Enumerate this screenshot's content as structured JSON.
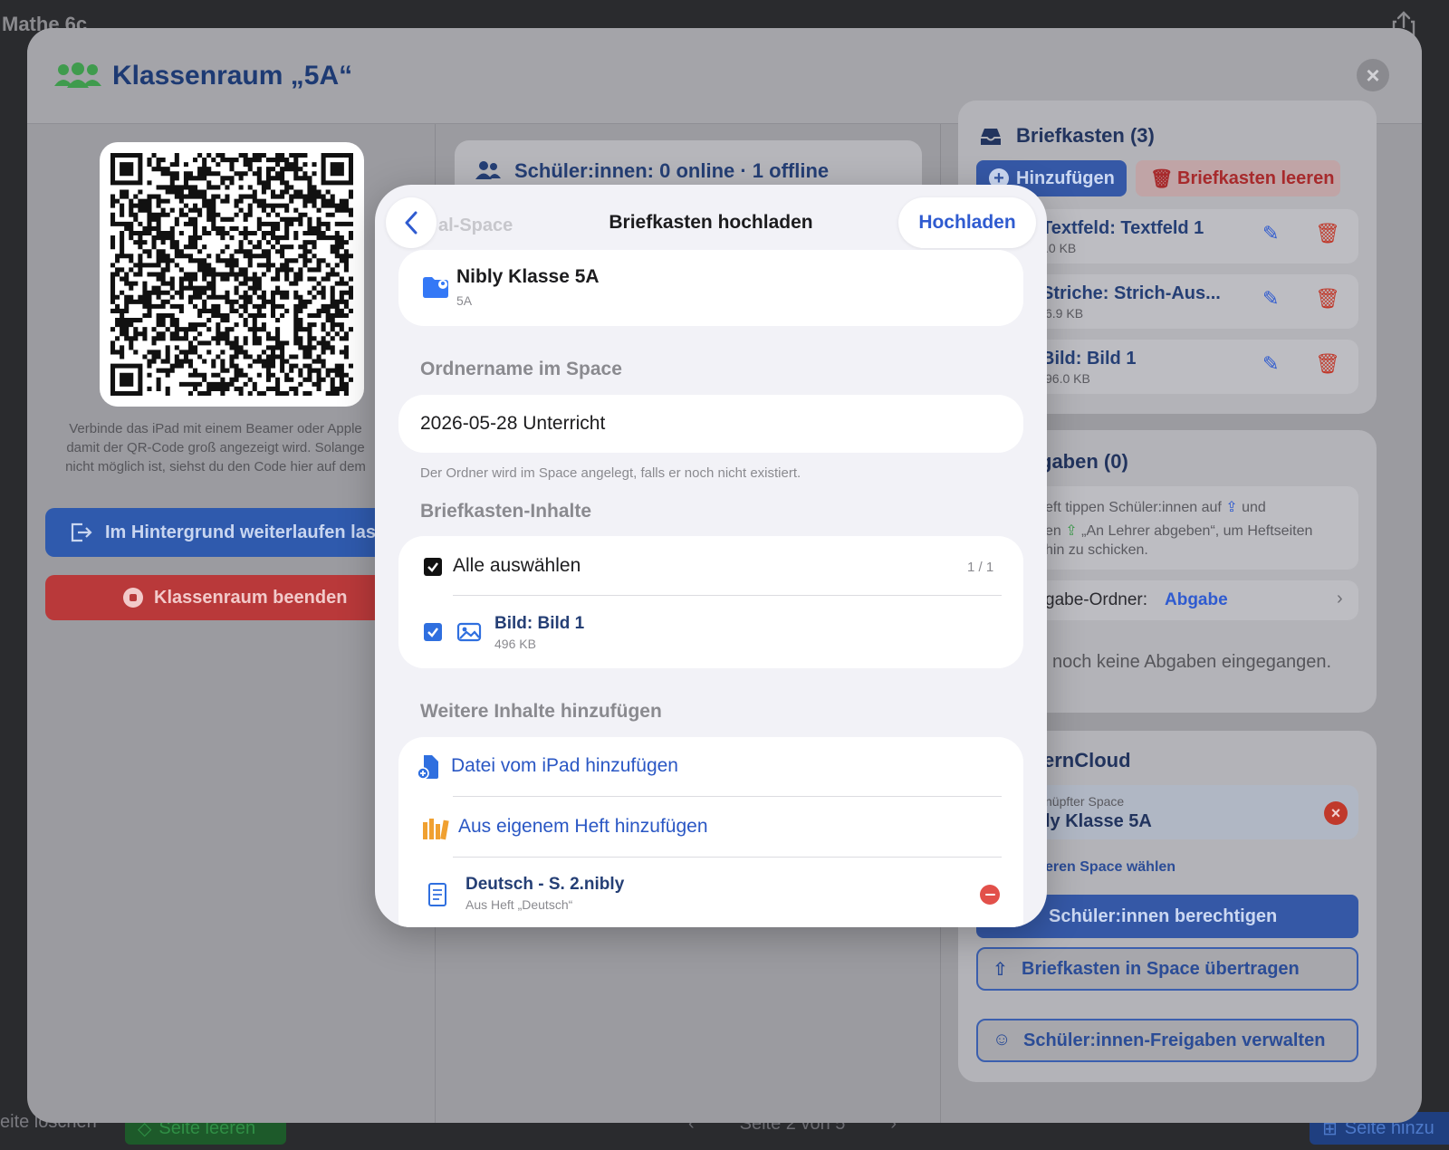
{
  "background": {
    "app_title": "Mathe 6c",
    "bottom_left": "eite löschen",
    "clear_page": "Seite leeren",
    "page_indicator": "Seite 2 von 5",
    "add_page": "Seite hinzu"
  },
  "sheet": {
    "title": "Klassenraum „5A“",
    "left": {
      "note": "Verbinde das iPad mit einem Beamer oder Apple\ndamit der QR-Code groß angezeigt wird. Solange\nnicht möglich ist, siehst du den Code hier auf dem",
      "background_button": "Im Hintergrund weiterlaufen lass",
      "end_button": "Klassenraum beenden"
    },
    "middle": {
      "students_status": "Schüler:innen: 0 online · 1 offline",
      "ghost_space": "al-Space"
    },
    "right": {
      "mailbox_title": "Briefkasten (3)",
      "add_button": "Hinzufügen",
      "clear_button": "Briefkasten leeren",
      "items": [
        {
          "name": "Textfeld: Textfeld 1",
          "size": ".0 KB"
        },
        {
          "name": "Striche: Strich-Aus...",
          "size": "6.9 KB"
        },
        {
          "name": "Bild: Bild 1",
          "size": "96.0 KB"
        }
      ],
      "submissions_title": "gaben (0)",
      "submissions_hint_1": "eft tippen Schüler:innen auf",
      "submissions_hint_1b": "und",
      "submissions_hint_2": "en",
      "submissions_hint_2b": "„An Lehrer abgeben“, um Heftseiten",
      "submissions_hint_3": "hin zu schicken.",
      "folder_label": "gabe-Ordner:",
      "folder_value": "Abgabe",
      "no_submissions": "l noch keine Abgaben eingegangen.",
      "cloud_title": "ernCloud",
      "linked_label": "nüpfter Space",
      "linked_value": "ly Klasse 5A",
      "choose_other": "eren Space wählen",
      "permit_button": "Schüler:innen berechtigen",
      "transfer_button": "Briefkasten in Space übertragen",
      "manage_button": "Schüler:innen-Freigaben verwalten"
    }
  },
  "modal": {
    "title": "Briefkasten hochladen",
    "upload_label": "Hochladen",
    "space": {
      "name": "Nibly Klasse 5A",
      "subtitle": "5A"
    },
    "folder_section": "Ordnername im Space",
    "folder_value": "2026-05-28 Unterricht",
    "folder_hint": "Der Ordner wird im Space angelegt, falls er noch nicht existiert.",
    "contents_section": "Briefkasten-Inhalte",
    "select_all": "Alle auswählen",
    "select_count": "1 / 1",
    "items": [
      {
        "name": "Bild: Bild 1",
        "size": "496 KB",
        "checked": true
      }
    ],
    "more_section": "Weitere Inhalte hinzufügen",
    "add_from_ipad": "Datei vom iPad hinzufügen",
    "add_from_notebook": "Aus eigenem Heft hinzufügen",
    "extra_items": [
      {
        "name": "Deutsch - S. 2.nibly",
        "source": "Aus Heft „Deutsch“"
      }
    ]
  },
  "colors": {
    "accent_blue": "#2f5bd0",
    "danger_red": "#e2504a",
    "success_green": "#34a853"
  }
}
